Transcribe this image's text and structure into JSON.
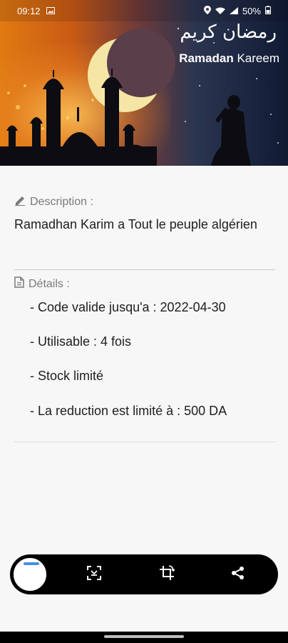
{
  "status_bar": {
    "time": "09:12",
    "battery": "50%",
    "icons": [
      "image-icon",
      "location-icon",
      "wifi-icon",
      "signal-icon",
      "battery-icon"
    ]
  },
  "banner": {
    "arabic_text": "رمضان كريم",
    "title_bold": "Ramadan",
    "title_regular": "Kareem"
  },
  "description": {
    "label": "Description :",
    "text": "Ramadhan Karim a Tout le peuple algérien"
  },
  "details": {
    "label": "Détails :",
    "items": [
      "- Code valide jusqu'a : 2022-04-30",
      "- Utilisable : 4 fois",
      "- Stock limité",
      "- La reduction est limité à : 500 DA"
    ]
  },
  "action_bar": {
    "buttons": [
      "qr-code-thumbnail",
      "scan-icon",
      "crop-rotate-icon",
      "share-icon"
    ]
  },
  "colors": {
    "accent_label": "#7a7a7a",
    "action_bar_bg": "#000000"
  }
}
